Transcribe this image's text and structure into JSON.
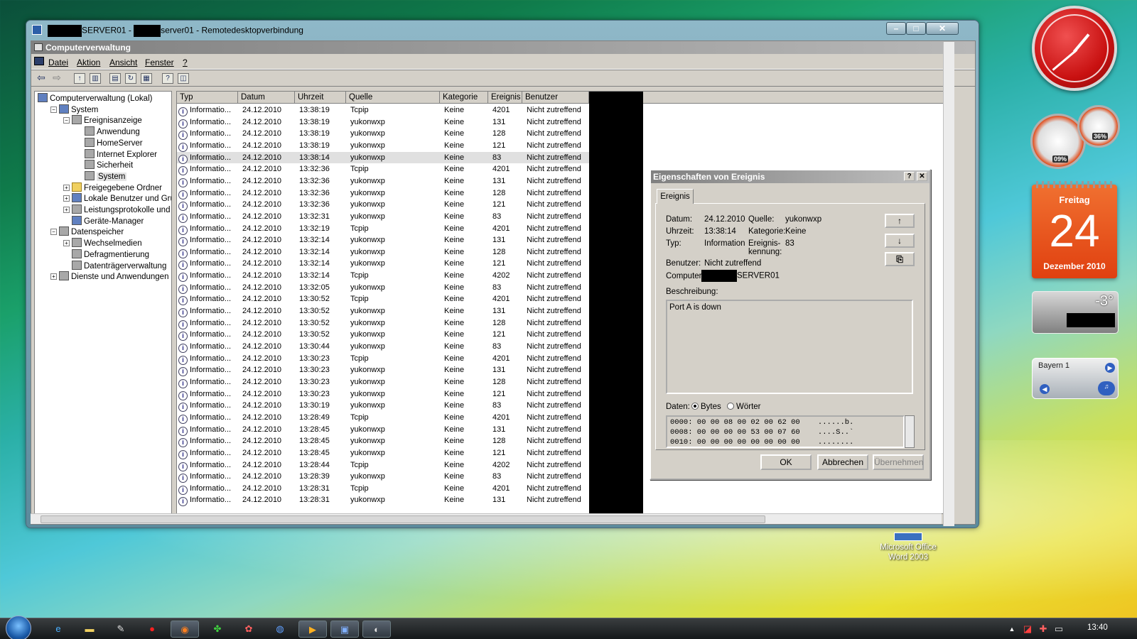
{
  "rdp": {
    "title_a": "SERVER01 -",
    "title_b": "server01 - Remotedesktopverbindung",
    "min": "–",
    "max": "□",
    "close": "✕"
  },
  "app": {
    "title": "Computerverwaltung",
    "menu": [
      "Datei",
      "Aktion",
      "Ansicht",
      "Fenster",
      "?"
    ]
  },
  "tree": [
    {
      "label": "Computerverwaltung (Lokal)",
      "indent": 0,
      "exp": "",
      "icon": "pc"
    },
    {
      "label": "System",
      "indent": 1,
      "exp": "–",
      "icon": "pc"
    },
    {
      "label": "Ereignisanzeige",
      "indent": 2,
      "exp": "–",
      "icon": "sv"
    },
    {
      "label": "Anwendung",
      "indent": 3,
      "exp": "",
      "icon": "sv"
    },
    {
      "label": "HomeServer",
      "indent": 3,
      "exp": "",
      "icon": "sv"
    },
    {
      "label": "Internet Explorer",
      "indent": 3,
      "exp": "",
      "icon": "sv"
    },
    {
      "label": "Sicherheit",
      "indent": 3,
      "exp": "",
      "icon": "sv"
    },
    {
      "label": "System",
      "indent": 3,
      "exp": "",
      "icon": "sv",
      "sel": true
    },
    {
      "label": "Freigegebene Ordner",
      "indent": 2,
      "exp": "+",
      "icon": "f"
    },
    {
      "label": "Lokale Benutzer und Gruppe",
      "indent": 2,
      "exp": "+",
      "icon": "pc"
    },
    {
      "label": "Leistungsprotokolle und War",
      "indent": 2,
      "exp": "+",
      "icon": "sv"
    },
    {
      "label": "Geräte-Manager",
      "indent": 2,
      "exp": "",
      "icon": "pc"
    },
    {
      "label": "Datenspeicher",
      "indent": 1,
      "exp": "–",
      "icon": "sv"
    },
    {
      "label": "Wechselmedien",
      "indent": 2,
      "exp": "+",
      "icon": "sv"
    },
    {
      "label": "Defragmentierung",
      "indent": 2,
      "exp": "",
      "icon": "sv"
    },
    {
      "label": "Datenträgerverwaltung",
      "indent": 2,
      "exp": "",
      "icon": "sv"
    },
    {
      "label": "Dienste und Anwendungen",
      "indent": 1,
      "exp": "+",
      "icon": "sv"
    }
  ],
  "list": {
    "headers": [
      "Typ",
      "Datum",
      "Uhrzeit",
      "Quelle",
      "Kategorie",
      "Ereignis",
      "Benutzer"
    ],
    "rows": [
      [
        "Informatio...",
        "24.12.2010",
        "13:38:19",
        "Tcpip",
        "Keine",
        "4201",
        "Nicht zutreffend"
      ],
      [
        "Informatio...",
        "24.12.2010",
        "13:38:19",
        "yukonwxp",
        "Keine",
        "131",
        "Nicht zutreffend"
      ],
      [
        "Informatio...",
        "24.12.2010",
        "13:38:19",
        "yukonwxp",
        "Keine",
        "128",
        "Nicht zutreffend"
      ],
      [
        "Informatio...",
        "24.12.2010",
        "13:38:19",
        "yukonwxp",
        "Keine",
        "121",
        "Nicht zutreffend"
      ],
      [
        "Informatio...",
        "24.12.2010",
        "13:38:14",
        "yukonwxp",
        "Keine",
        "83",
        "Nicht zutreffend"
      ],
      [
        "Informatio...",
        "24.12.2010",
        "13:32:36",
        "Tcpip",
        "Keine",
        "4201",
        "Nicht zutreffend"
      ],
      [
        "Informatio...",
        "24.12.2010",
        "13:32:36",
        "yukonwxp",
        "Keine",
        "131",
        "Nicht zutreffend"
      ],
      [
        "Informatio...",
        "24.12.2010",
        "13:32:36",
        "yukonwxp",
        "Keine",
        "128",
        "Nicht zutreffend"
      ],
      [
        "Informatio...",
        "24.12.2010",
        "13:32:36",
        "yukonwxp",
        "Keine",
        "121",
        "Nicht zutreffend"
      ],
      [
        "Informatio...",
        "24.12.2010",
        "13:32:31",
        "yukonwxp",
        "Keine",
        "83",
        "Nicht zutreffend"
      ],
      [
        "Informatio...",
        "24.12.2010",
        "13:32:19",
        "Tcpip",
        "Keine",
        "4201",
        "Nicht zutreffend"
      ],
      [
        "Informatio...",
        "24.12.2010",
        "13:32:14",
        "yukonwxp",
        "Keine",
        "131",
        "Nicht zutreffend"
      ],
      [
        "Informatio...",
        "24.12.2010",
        "13:32:14",
        "yukonwxp",
        "Keine",
        "128",
        "Nicht zutreffend"
      ],
      [
        "Informatio...",
        "24.12.2010",
        "13:32:14",
        "yukonwxp",
        "Keine",
        "121",
        "Nicht zutreffend"
      ],
      [
        "Informatio...",
        "24.12.2010",
        "13:32:14",
        "Tcpip",
        "Keine",
        "4202",
        "Nicht zutreffend"
      ],
      [
        "Informatio...",
        "24.12.2010",
        "13:32:05",
        "yukonwxp",
        "Keine",
        "83",
        "Nicht zutreffend"
      ],
      [
        "Informatio...",
        "24.12.2010",
        "13:30:52",
        "Tcpip",
        "Keine",
        "4201",
        "Nicht zutreffend"
      ],
      [
        "Informatio...",
        "24.12.2010",
        "13:30:52",
        "yukonwxp",
        "Keine",
        "131",
        "Nicht zutreffend"
      ],
      [
        "Informatio...",
        "24.12.2010",
        "13:30:52",
        "yukonwxp",
        "Keine",
        "128",
        "Nicht zutreffend"
      ],
      [
        "Informatio...",
        "24.12.2010",
        "13:30:52",
        "yukonwxp",
        "Keine",
        "121",
        "Nicht zutreffend"
      ],
      [
        "Informatio...",
        "24.12.2010",
        "13:30:44",
        "yukonwxp",
        "Keine",
        "83",
        "Nicht zutreffend"
      ],
      [
        "Informatio...",
        "24.12.2010",
        "13:30:23",
        "Tcpip",
        "Keine",
        "4201",
        "Nicht zutreffend"
      ],
      [
        "Informatio...",
        "24.12.2010",
        "13:30:23",
        "yukonwxp",
        "Keine",
        "131",
        "Nicht zutreffend"
      ],
      [
        "Informatio...",
        "24.12.2010",
        "13:30:23",
        "yukonwxp",
        "Keine",
        "128",
        "Nicht zutreffend"
      ],
      [
        "Informatio...",
        "24.12.2010",
        "13:30:23",
        "yukonwxp",
        "Keine",
        "121",
        "Nicht zutreffend"
      ],
      [
        "Informatio...",
        "24.12.2010",
        "13:30:19",
        "yukonwxp",
        "Keine",
        "83",
        "Nicht zutreffend"
      ],
      [
        "Informatio...",
        "24.12.2010",
        "13:28:49",
        "Tcpip",
        "Keine",
        "4201",
        "Nicht zutreffend"
      ],
      [
        "Informatio...",
        "24.12.2010",
        "13:28:45",
        "yukonwxp",
        "Keine",
        "131",
        "Nicht zutreffend"
      ],
      [
        "Informatio...",
        "24.12.2010",
        "13:28:45",
        "yukonwxp",
        "Keine",
        "128",
        "Nicht zutreffend"
      ],
      [
        "Informatio...",
        "24.12.2010",
        "13:28:45",
        "yukonwxp",
        "Keine",
        "121",
        "Nicht zutreffend"
      ],
      [
        "Informatio...",
        "24.12.2010",
        "13:28:44",
        "Tcpip",
        "Keine",
        "4202",
        "Nicht zutreffend"
      ],
      [
        "Informatio...",
        "24.12.2010",
        "13:28:39",
        "yukonwxp",
        "Keine",
        "83",
        "Nicht zutreffend"
      ],
      [
        "Informatio...",
        "24.12.2010",
        "13:28:31",
        "Tcpip",
        "Keine",
        "4201",
        "Nicht zutreffend"
      ],
      [
        "Informatio...",
        "24.12.2010",
        "13:28:31",
        "yukonwxp",
        "Keine",
        "131",
        "Nicht zutreffend"
      ]
    ],
    "selected_row": 4
  },
  "dialog": {
    "title": "Eigenschaften von Ereignis",
    "help": "?",
    "close": "✕",
    "tab": "Ereignis",
    "datum_label": "Datum:",
    "datum": "24.12.2010",
    "quelle_label": "Quelle:",
    "quelle": "yukonwxp",
    "uhrzeit_label": "Uhrzeit:",
    "uhrzeit": "13:38:14",
    "kategorie_label": "Kategorie:",
    "kategorie": "Keine",
    "typ_label": "Typ:",
    "typ": "Information",
    "kennung_label_1": "Ereignis-",
    "kennung_label_2": "kennung:",
    "kennung": "83",
    "benutzer_label": "Benutzer:",
    "benutzer": "Nicht zutreffend",
    "computer_label": "Computer:",
    "computer": "SERVER01",
    "beschreibung_label": "Beschreibung:",
    "beschreibung": "Port A is down",
    "daten_label": "Daten:",
    "bytes": "Bytes",
    "woerter": "Wörter",
    "hex": "0000: 00 00 08 00 02 00 62 00    ......b.\n0008: 00 00 00 00 53 00 07 60    ....S..`\n0010: 00 00 00 00 00 00 00 00    ........",
    "ok": "OK",
    "abbrechen": "Abbrechen",
    "uebernehmen": "Übernehmen"
  },
  "gadgets": {
    "meter_cpu": "09%",
    "meter_mem": "36%",
    "cal_day": "Freitag",
    "cal_num": "24",
    "cal_month": "Dezember 2010",
    "temp": "-3°",
    "radio": "Bayern 1"
  },
  "desktop": {
    "icon_line1": "Microsoft Office",
    "icon_line2": "Word 2003"
  },
  "taskbar": {
    "time": "13:40"
  }
}
